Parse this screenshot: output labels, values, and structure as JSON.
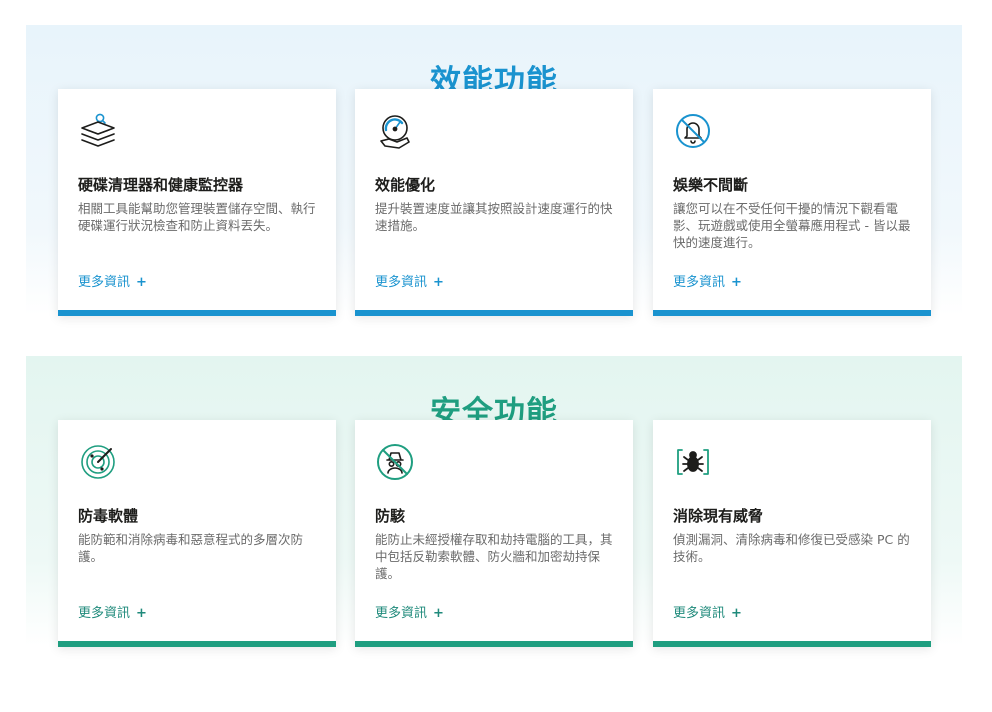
{
  "performance": {
    "title": "效能功能",
    "accent_color": "#1a93cf",
    "cards": [
      {
        "icon": "disk-cleaner-icon",
        "title": "硬碟清理器和健康監控器",
        "desc": "相關工具能幫助您管理裝置儲存空間、執行硬碟運行狀況檢查和防止資料丟失。",
        "link": "更多資訊",
        "link_suffix": "+"
      },
      {
        "icon": "speed-gauge-icon",
        "title": "效能優化",
        "desc": "提升裝置速度並讓其按照設計速度運行的快速措施。",
        "link": "更多資訊",
        "link_suffix": "+"
      },
      {
        "icon": "no-notification-icon",
        "title": "娛樂不間斷",
        "desc": "讓您可以在不受任何干擾的情況下觀看電影、玩遊戲或使用全螢幕應用程式 - 皆以最快的速度進行。",
        "link": "更多資訊",
        "link_suffix": "+"
      }
    ]
  },
  "security": {
    "title": "安全功能",
    "accent_color": "#1f9e80",
    "cards": [
      {
        "icon": "radar-icon",
        "title": "防毒軟體",
        "desc": "能防範和消除病毒和惡意程式的多層次防護。",
        "link": "更多資訊",
        "link_suffix": "+"
      },
      {
        "icon": "anti-hacker-icon",
        "title": "防駭",
        "desc": "能防止未經授權存取和劫持電腦的工具，其中包括反勒索軟體、防火牆和加密劫持保護。",
        "link": "更多資訊",
        "link_suffix": "+"
      },
      {
        "icon": "bug-icon",
        "title": "消除現有威脅",
        "desc": "偵測漏洞、清除病毒和修復已受感染 PC 的技術。",
        "link": "更多資訊",
        "link_suffix": "+"
      }
    ]
  }
}
